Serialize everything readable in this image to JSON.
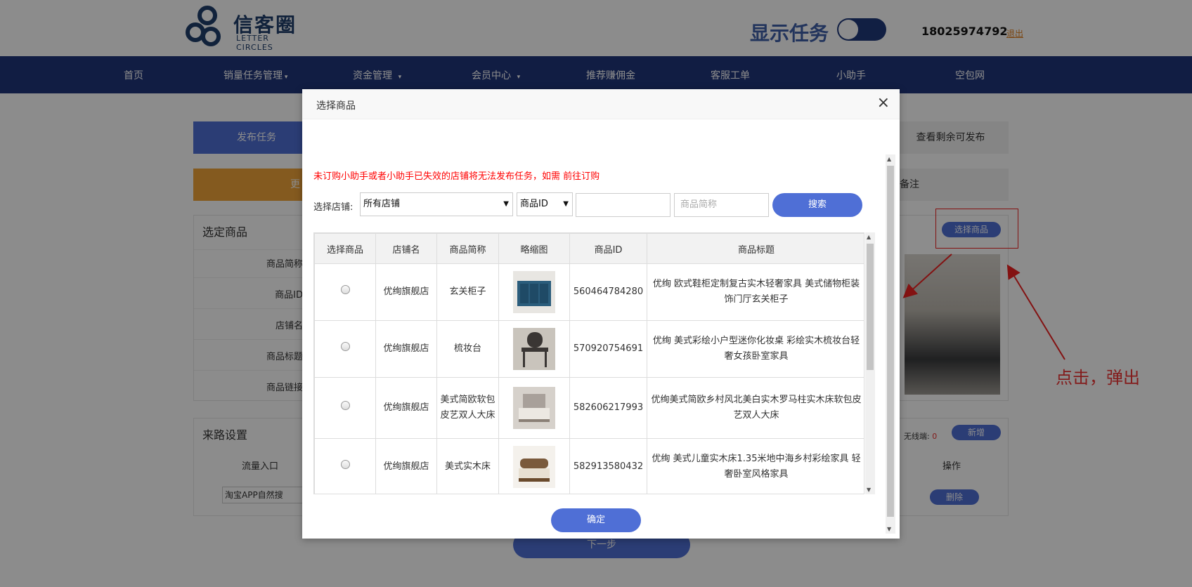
{
  "header": {
    "logo_cn": "信客圈",
    "logo_en": "LETTER CIRCLES",
    "task_toggle_label": "显示任务",
    "phone": "18025974792",
    "logout": "退出"
  },
  "nav": {
    "items": [
      "首页",
      "销量任务管理",
      "资金管理",
      "会员中心",
      "推荐赚佣金",
      "客服工单",
      "小助手",
      "空包网"
    ]
  },
  "page": {
    "tab_publish": "发布任务",
    "tab_remaining": "查看剩余可发布",
    "orange_text": "更",
    "remark_text": "备注",
    "section_product": "选定商品",
    "product_rows": [
      "商品简称",
      "商品ID",
      "店铺名",
      "商品标题",
      "商品链接"
    ],
    "select_product_button": "选择商品",
    "section_source": "来路设置",
    "traffic_entry": "流量入口",
    "source_select": "淘宝APP自然搜",
    "no_wireless": "无线端:",
    "no_wireless_count": "0",
    "add_button": "新增",
    "operate": "操作",
    "delete_button": "删除",
    "next_button": "下一步"
  },
  "annotation": {
    "text": "点击，弹出",
    "color": "#e33333"
  },
  "modal": {
    "title": "选择商品",
    "close": "×",
    "warning": "未订购小助手或者小助手已失效的店铺将无法发布任务，如需 前往订购",
    "shop_label": "选择店铺:",
    "shop_select": "所有店铺",
    "field_select": "商品ID",
    "keyword_placeholder": "",
    "short_name_placeholder": "商品简称",
    "search_button": "搜索",
    "confirm_button": "确定",
    "table": {
      "headers": [
        "选择商品",
        "店铺名",
        "商品简称",
        "略缩图",
        "商品ID",
        "商品标题"
      ],
      "rows": [
        {
          "shop": "优绚旗舰店",
          "short": "玄关柜子",
          "id": "560464784280",
          "title": "优绚 欧式鞋柜定制复古实木轻奢家具 美式储物柜装饰门厅玄关柜子",
          "thumb_color": "#2b5d7c"
        },
        {
          "shop": "优绚旗舰店",
          "short": "梳妆台",
          "id": "570920754691",
          "title": "优绚 美式彩绘小户型迷你化妆桌 彩绘实木梳妆台轻奢女孩卧室家具",
          "thumb_color": "#3a3634"
        },
        {
          "shop": "优绚旗舰店",
          "short": "美式简欧软包皮艺双人大床",
          "id": "582606217993",
          "title": "优绚美式简欧乡村风北美白实木罗马柱实木床软包皮艺双人大床",
          "thumb_color": "#a8a09a"
        },
        {
          "shop": "优绚旗舰店",
          "short": "美式实木床",
          "id": "582913580432",
          "title": "优绚 美式儿童实木床1.35米地中海乡村彩绘家具 轻奢卧室风格家具",
          "thumb_color": "#7a5a3c"
        }
      ]
    }
  },
  "colors": {
    "nav_bg": "#20357a",
    "primary": "#4f6fd6",
    "warning": "#ff0000",
    "accent_orange": "#f0a53a"
  }
}
